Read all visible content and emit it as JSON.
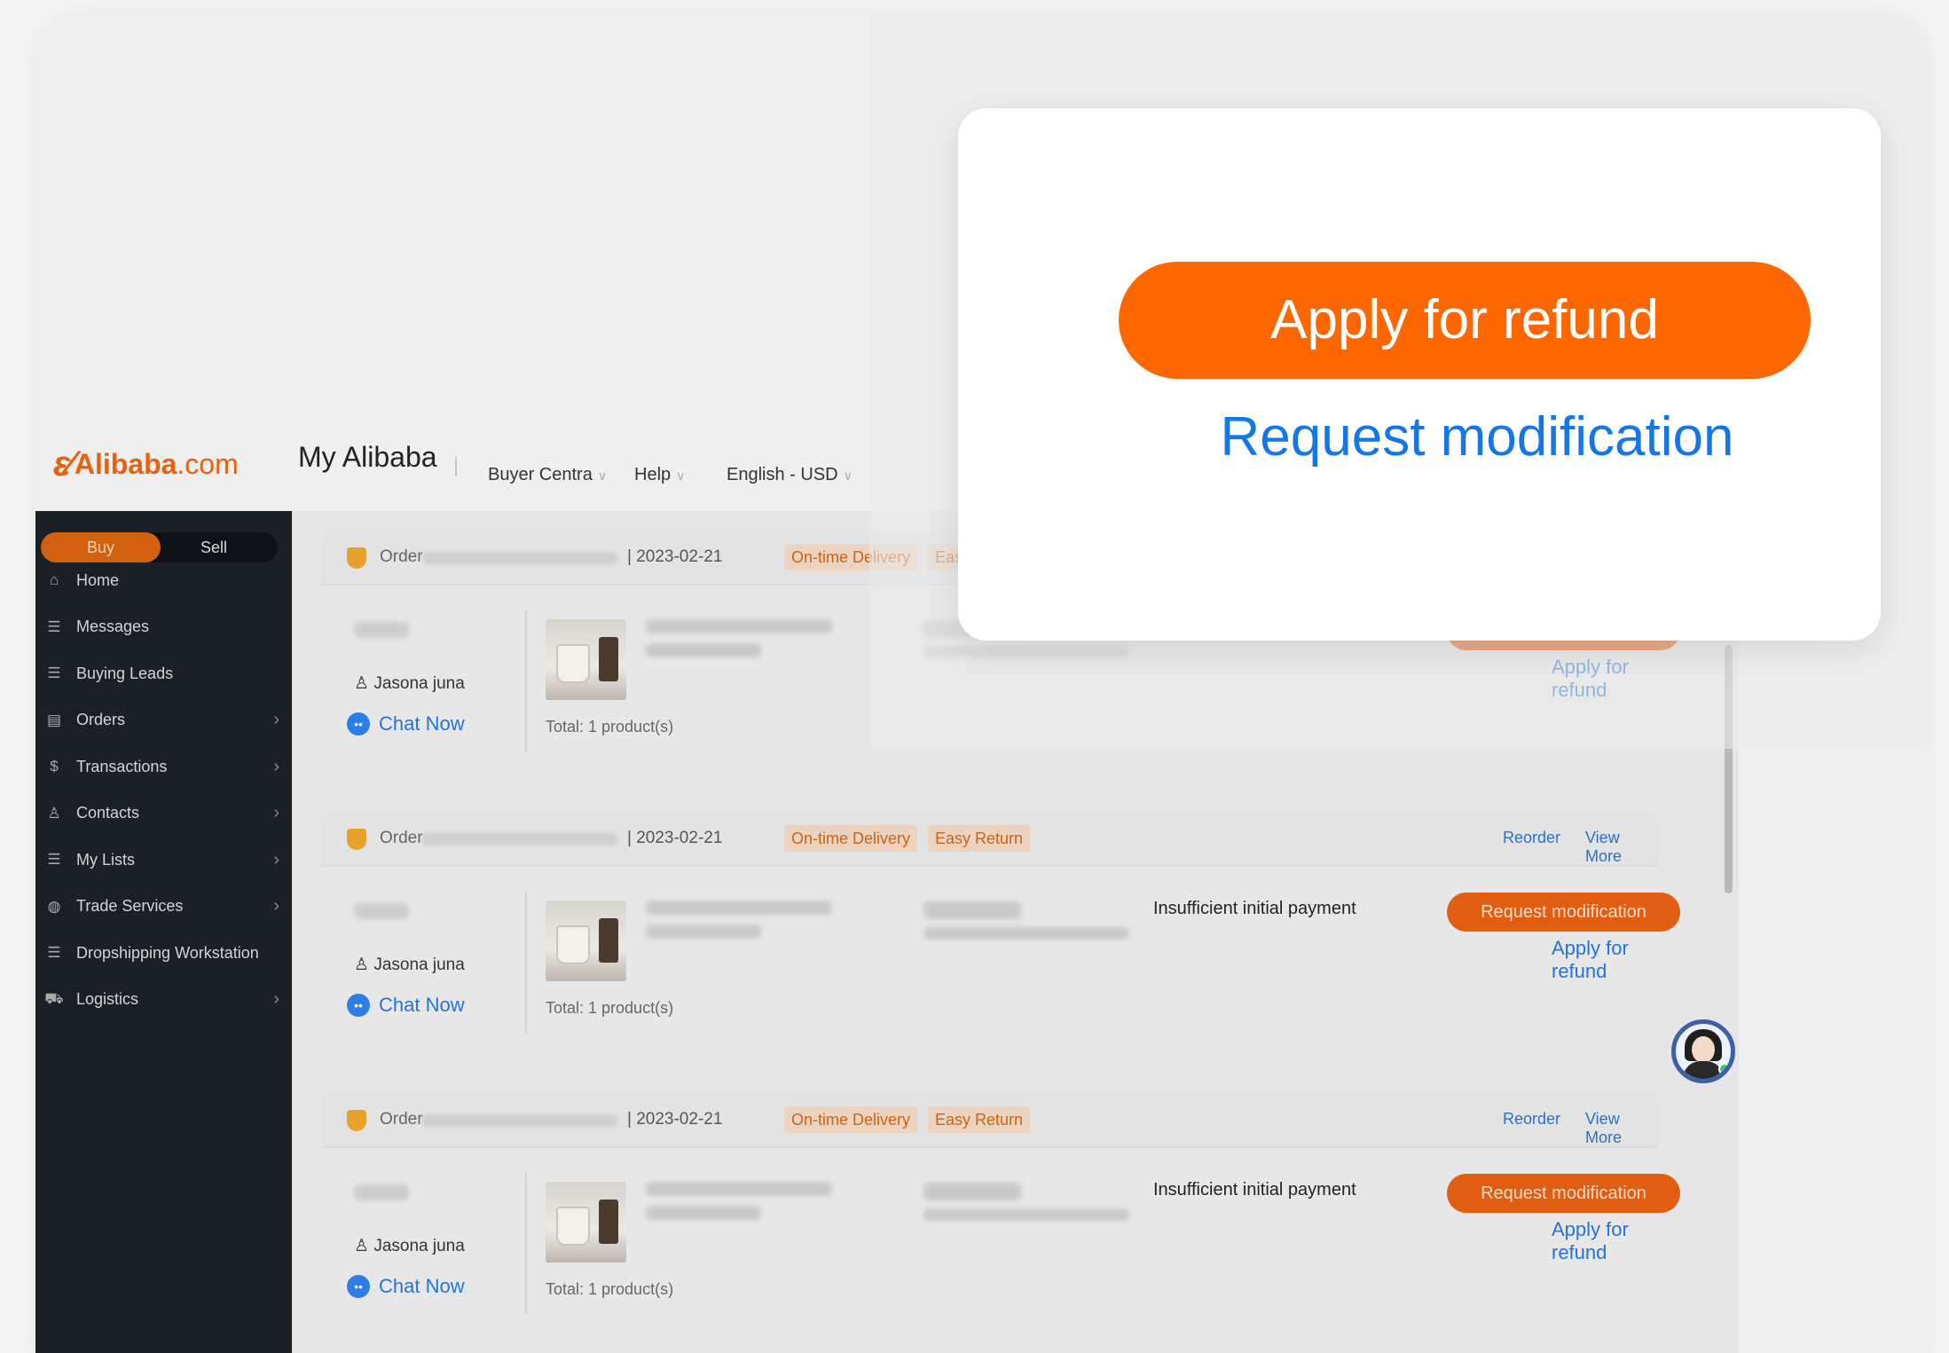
{
  "header": {
    "brand_main": "Alibaba",
    "brand_suffix": ".com",
    "title": "My Alibaba",
    "nav": [
      "Buyer Centra",
      "Help",
      "English - USD"
    ]
  },
  "sidebar": {
    "toggle": {
      "buy": "Buy",
      "sell": "Sell"
    },
    "items": [
      {
        "label": "Home",
        "icon": "home-icon",
        "glyph": "⌂",
        "arrow": false
      },
      {
        "label": "Messages",
        "icon": "list-icon",
        "glyph": "☰",
        "arrow": false
      },
      {
        "label": "Buying Leads",
        "icon": "list-icon",
        "glyph": "☰",
        "arrow": false
      },
      {
        "label": "Orders",
        "icon": "document-icon",
        "glyph": "▤",
        "arrow": true
      },
      {
        "label": "Transactions",
        "icon": "dollar-icon",
        "glyph": "$",
        "arrow": true
      },
      {
        "label": "Contacts",
        "icon": "contacts-icon",
        "glyph": "♙",
        "arrow": true
      },
      {
        "label": "My Lists",
        "icon": "list-icon",
        "glyph": "☰",
        "arrow": true
      },
      {
        "label": "Trade Services",
        "icon": "globe-icon",
        "glyph": "◍",
        "arrow": true
      },
      {
        "label": "Dropshipping Workstation",
        "icon": "list-icon",
        "glyph": "☰",
        "arrow": false
      },
      {
        "label": "Logistics",
        "icon": "truck-icon",
        "glyph": "⛟",
        "arrow": true
      }
    ],
    "arrow_glyph": "›"
  },
  "orders": {
    "order_label": "Order",
    "date": "| 2023-02-21",
    "tags": [
      "On-time Delivery",
      "Easy Return"
    ],
    "reorder": "Reorder",
    "view_more": "View More",
    "buyer": "Jasona juna",
    "chat": "Chat Now",
    "total": "Total:  1 product(s)",
    "status": "Insufficient initial payment",
    "request_btn": "Request modification",
    "refund_link": "Apply for refund"
  },
  "popup": {
    "primary": "Apply for refund",
    "secondary": "Request modification"
  },
  "colors": {
    "accent_orange": "#fe6600",
    "link_blue": "#1576e8",
    "sidebar_bg": "#1b2027"
  }
}
